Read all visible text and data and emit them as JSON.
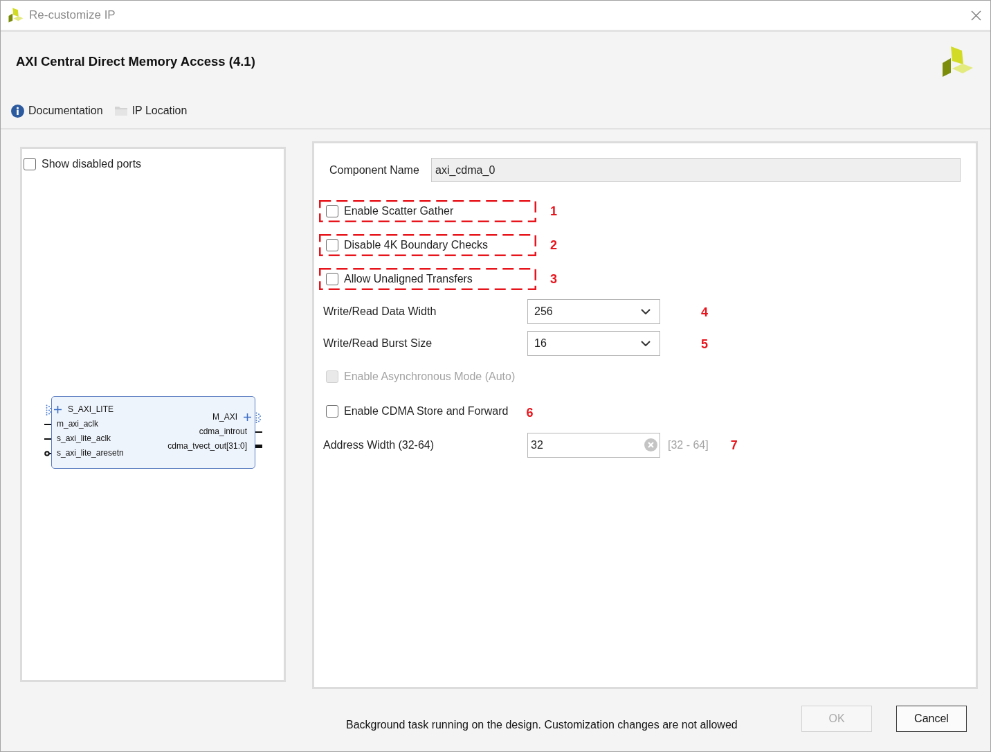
{
  "window": {
    "title": "Re-customize IP"
  },
  "header": {
    "title": "AXI Central Direct Memory Access (4.1)",
    "links": [
      {
        "kind": "info",
        "label": "Documentation"
      },
      {
        "kind": "folder",
        "label": "IP Location"
      }
    ]
  },
  "preview": {
    "show_disabled_ports": {
      "label": "Show disabled ports",
      "checked": false
    },
    "block": {
      "left_ports": [
        {
          "kind": "interface",
          "name": "S_AXI_LITE"
        },
        {
          "kind": "signal",
          "name": "m_axi_aclk"
        },
        {
          "kind": "signal",
          "name": "s_axi_lite_aclk"
        },
        {
          "kind": "active_low",
          "name": "s_axi_lite_aresetn"
        }
      ],
      "right_ports": [
        {
          "kind": "interface",
          "name": "M_AXI"
        },
        {
          "kind": "signal",
          "name": "cdma_introut"
        },
        {
          "kind": "vector",
          "name": "cdma_tvect_out[31:0]"
        }
      ]
    }
  },
  "settings": {
    "component_name": {
      "label": "Component Name",
      "value": "axi_cdma_0"
    },
    "options": [
      {
        "kind": "checkbox",
        "label": "Enable Scatter Gather",
        "checked": false,
        "disabled": false,
        "annotation_frame": true,
        "annotation_number": "1"
      },
      {
        "kind": "checkbox",
        "label": "Disable 4K Boundary Checks",
        "checked": false,
        "disabled": false,
        "annotation_frame": true,
        "annotation_number": "2"
      },
      {
        "kind": "checkbox",
        "label": "Allow Unaligned Transfers",
        "checked": false,
        "disabled": false,
        "annotation_frame": true,
        "annotation_number": "3"
      },
      {
        "kind": "dropdown",
        "label": "Write/Read Data Width",
        "value": "256",
        "annotation_number": "4"
      },
      {
        "kind": "dropdown",
        "label": "Write/Read Burst Size",
        "value": "16",
        "annotation_number": "5"
      },
      {
        "kind": "checkbox",
        "label": "Enable Asynchronous Mode (Auto)",
        "checked": false,
        "disabled": true,
        "annotation_frame": false
      },
      {
        "kind": "checkbox",
        "label": "Enable CDMA Store and Forward",
        "checked": false,
        "disabled": false,
        "annotation_frame": false,
        "annotation_number": "6"
      },
      {
        "kind": "number_input",
        "label": "Address Width (32-64)",
        "value": "32",
        "range": "[32 - 64]",
        "annotation_number": "7"
      }
    ]
  },
  "footer": {
    "message": "Background task running on the design. Customization changes are not allowed",
    "buttons": [
      {
        "label": "OK",
        "disabled": true
      },
      {
        "label": "Cancel",
        "disabled": false
      }
    ]
  }
}
